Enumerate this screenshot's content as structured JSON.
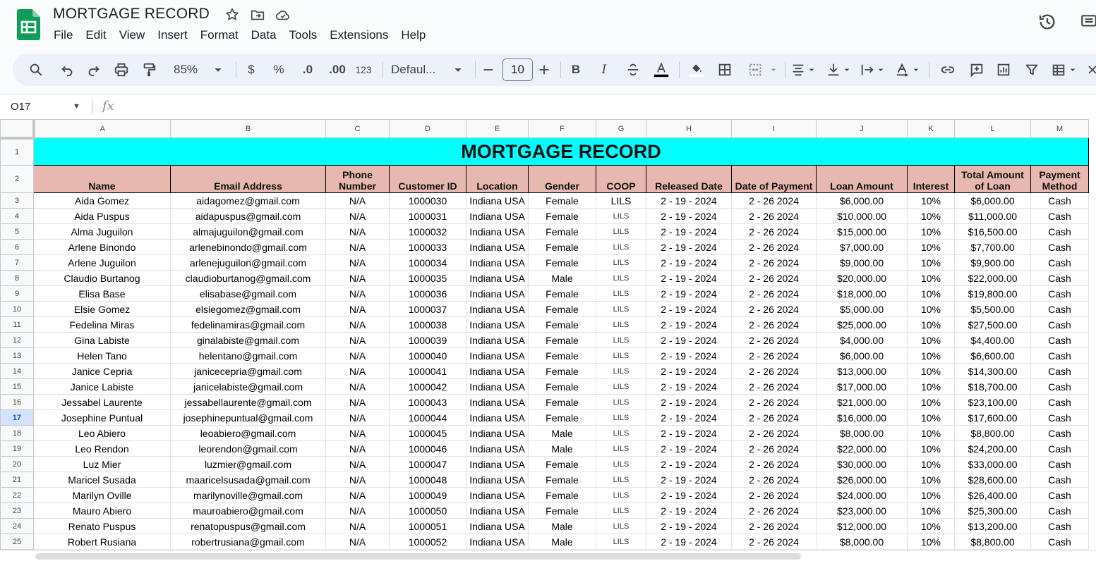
{
  "app": {
    "title": "MORTGAGE RECORD",
    "menu": [
      "File",
      "Edit",
      "View",
      "Insert",
      "Format",
      "Data",
      "Tools",
      "Extensions",
      "Help"
    ]
  },
  "toolbar": {
    "zoom": "85%",
    "currency": "$",
    "percent": "%",
    "dec_decrease": ".0",
    "dec_increase": ".00",
    "number_format": "123",
    "font": "Defaul...",
    "font_size": "10",
    "bold": "B",
    "italic": "I"
  },
  "formula_bar": {
    "cell_ref": "O17",
    "fx": "fx"
  },
  "grid": {
    "columns": [
      "A",
      "B",
      "C",
      "D",
      "E",
      "F",
      "G",
      "H",
      "I",
      "J",
      "K",
      "L",
      "M"
    ],
    "selected_row": 17,
    "sheet_title": "MORTGAGE RECORD",
    "headers": [
      "Name",
      "Email Address",
      "Phone Number",
      "Customer ID",
      "Location",
      "Gender",
      "COOP",
      "Released Date",
      "Date of Payment",
      "Loan Amount",
      "Interest",
      "Total Amount of Loan",
      "Payment Method"
    ],
    "rows": [
      [
        "Aida Gomez",
        "aidagomez@gmail.com",
        "N/A",
        "1000030",
        "Indiana USA",
        "Female",
        "LILS",
        "2 - 19 - 2024",
        "2 - 26  2024",
        "$6,000.00",
        "10%",
        "$6,000.00",
        "Cash"
      ],
      [
        "Aida Puspus",
        "aidapuspus@gmail.com",
        "N/A",
        "1000031",
        "Indiana USA",
        "Female",
        "LILS",
        "2 - 19 - 2024",
        "2 - 26  2024",
        "$10,000.00",
        "10%",
        "$11,000.00",
        "Cash"
      ],
      [
        "Alma Juguilon",
        "almajuguilon@gmail.com",
        "N/A",
        "1000032",
        "Indiana USA",
        "Female",
        "LILS",
        "2 - 19 - 2024",
        "2 - 26  2024",
        "$15,000.00",
        "10%",
        "$16,500.00",
        "Cash"
      ],
      [
        "Arlene Binondo",
        "arlenebinondo@gmail.com",
        "N/A",
        "1000033",
        "Indiana USA",
        "Female",
        "LILS",
        "2 - 19 - 2024",
        "2 - 26  2024",
        "$7,000.00",
        "10%",
        "$7,700.00",
        "Cash"
      ],
      [
        "Arlene Juguilon",
        "arlenejuguilon@gmail.com",
        "N/A",
        "1000034",
        "Indiana USA",
        "Female",
        "LILS",
        "2 - 19 - 2024",
        "2 - 26  2024",
        "$9,000.00",
        "10%",
        "$9,900.00",
        "Cash"
      ],
      [
        "Claudio Burtanog",
        "claudioburtanog@gmail.com",
        "N/A",
        "1000035",
        "Indiana USA",
        "Male",
        "LILS",
        "2 - 19 - 2024",
        "2 - 26  2024",
        "$20,000.00",
        "10%",
        "$22,000.00",
        "Cash"
      ],
      [
        "Elisa Base",
        "elisabase@gmail.com",
        "N/A",
        "1000036",
        "Indiana USA",
        "Female",
        "LILS",
        "2 - 19 - 2024",
        "2 - 26  2024",
        "$18,000.00",
        "10%",
        "$19,800.00",
        "Cash"
      ],
      [
        "Elsie Gomez",
        "elsiegomez@gmail.com",
        "N/A",
        "1000037",
        "Indiana USA",
        "Female",
        "LILS",
        "2 - 19 - 2024",
        "2 - 26  2024",
        "$5,000.00",
        "10%",
        "$5,500.00",
        "Cash"
      ],
      [
        "Fedelina Miras",
        "fedelinamiras@gmail.com",
        "N/A",
        "1000038",
        "Indiana USA",
        "Female",
        "LILS",
        "2 - 19 - 2024",
        "2 - 26  2024",
        "$25,000.00",
        "10%",
        "$27,500.00",
        "Cash"
      ],
      [
        "Gina Labiste",
        "ginalabiste@gmail.com",
        "N/A",
        "1000039",
        "Indiana USA",
        "Female",
        "LILS",
        "2 - 19 - 2024",
        "2 - 26  2024",
        "$4,000.00",
        "10%",
        "$4,400.00",
        "Cash"
      ],
      [
        "Helen Tano",
        "helentano@gmail.com",
        "N/A",
        "1000040",
        "Indiana USA",
        "Female",
        "LILS",
        "2 - 19 - 2024",
        "2 - 26  2024",
        "$6,000.00",
        "10%",
        "$6,600.00",
        "Cash"
      ],
      [
        "Janice Cepria",
        "janicecepria@gmail.com",
        "N/A",
        "1000041",
        "Indiana USA",
        "Female",
        "LILS",
        "2 - 19 - 2024",
        "2 - 26  2024",
        "$13,000.00",
        "10%",
        "$14,300.00",
        "Cash"
      ],
      [
        "Janice Labiste",
        "janicelabiste@gmail.com",
        "N/A",
        "1000042",
        "Indiana USA",
        "Female",
        "LILS",
        "2 - 19 - 2024",
        "2 - 26  2024",
        "$17,000.00",
        "10%",
        "$18,700.00",
        "Cash"
      ],
      [
        "Jessabel Laurente",
        "jessabellaurente@gmail.com",
        "N/A",
        "1000043",
        "Indiana USA",
        "Female",
        "LILS",
        "2 - 19 - 2024",
        "2 - 26  2024",
        "$21,000.00",
        "10%",
        "$23,100.00",
        "Cash"
      ],
      [
        "Josephine Puntual",
        "josephinepuntual@gmail.com",
        "N/A",
        "1000044",
        "Indiana USA",
        "Female",
        "LILS",
        "2 - 19 - 2024",
        "2 - 26  2024",
        "$16,000.00",
        "10%",
        "$17,600.00",
        "Cash"
      ],
      [
        "Leo Abiero",
        "leoabiero@gmail.com",
        "N/A",
        "1000045",
        "Indiana USA",
        "Male",
        "LILS",
        "2 - 19 - 2024",
        "2 - 26  2024",
        "$8,000.00",
        "10%",
        "$8,800.00",
        "Cash"
      ],
      [
        "Leo Rendon",
        "leorendon@gmail.com",
        "N/A",
        "1000046",
        "Indiana USA",
        "Male",
        "LILS",
        "2 - 19 - 2024",
        "2 - 26  2024",
        "$22,000.00",
        "10%",
        "$24,200.00",
        "Cash"
      ],
      [
        "Luz Mier",
        "luzmier@gmail.com",
        "N/A",
        "1000047",
        "Indiana USA",
        "Female",
        "LILS",
        "2 - 19 - 2024",
        "2 - 26  2024",
        "$30,000.00",
        "10%",
        "$33,000.00",
        "Cash"
      ],
      [
        "Maricel Susada",
        "maaricelsusada@gmail.com",
        "N/A",
        "1000048",
        "Indiana USA",
        "Female",
        "LILS",
        "2 - 19 - 2024",
        "2 - 26  2024",
        "$26,000.00",
        "10%",
        "$28,600.00",
        "Cash"
      ],
      [
        "Marilyn Oville",
        "marilynoville@gmail.com",
        "N/A",
        "1000049",
        "Indiana USA",
        "Female",
        "LILS",
        "2 - 19 - 2024",
        "2 - 26  2024",
        "$24,000.00",
        "10%",
        "$26,400.00",
        "Cash"
      ],
      [
        "Mauro Abiero",
        "mauroabiero@gmail.com",
        "N/A",
        "1000050",
        "Indiana USA",
        "Female",
        "LILS",
        "2 - 19 - 2024",
        "2 - 26  2024",
        "$23,000.00",
        "10%",
        "$25,300.00",
        "Cash"
      ],
      [
        "Renato Puspus",
        "renatopuspus@gmail.com",
        "N/A",
        "1000051",
        "Indiana USA",
        "Male",
        "LILS",
        "2 - 19 - 2024",
        "2 - 26  2024",
        "$12,000.00",
        "10%",
        "$13,200.00",
        "Cash"
      ],
      [
        "Robert Rusiana",
        "robertrusiana@gmail.com",
        "N/A",
        "1000052",
        "Indiana USA",
        "Male",
        "LILS",
        "2 - 19 - 2024",
        "2 - 26  2024",
        "$8,000.00",
        "10%",
        "$8,800.00",
        "Cash"
      ]
    ]
  },
  "colors": {
    "title_fill": "#00ffff",
    "header_fill": "#e6b8af",
    "sheets_green": "#0f9d58",
    "selection_blue": "#d3e3fd"
  }
}
